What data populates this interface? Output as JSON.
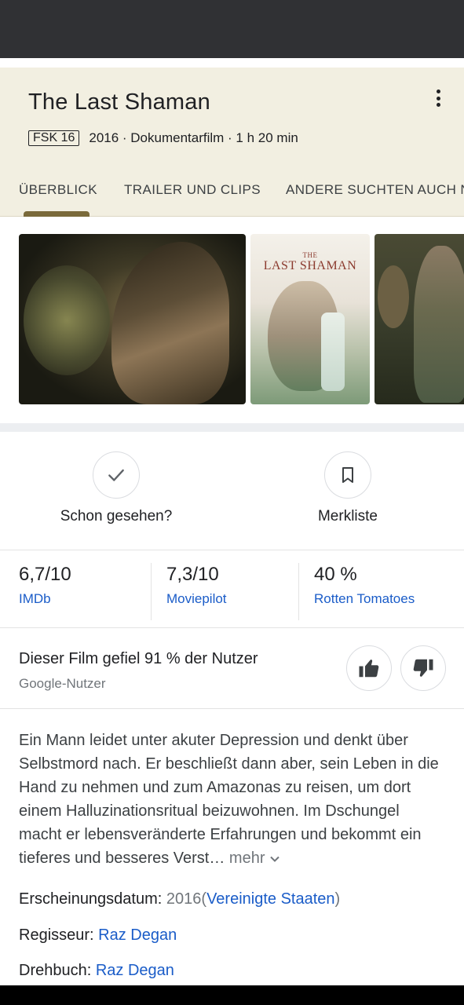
{
  "header": {
    "title": "The Last Shaman",
    "rating_badge": "FSK 16",
    "meta": "2016 · Dokumentarfilm · 1 h 20 min"
  },
  "tabs": [
    {
      "label": "ÜBERBLICK",
      "active": true
    },
    {
      "label": "TRAILER UND CLIPS",
      "active": false
    },
    {
      "label": "ANDERE SUCHTEN AUCH NACH",
      "active": false
    }
  ],
  "gallery": {
    "poster_title_line1": "THE",
    "poster_title_line2": "LAST SHAMAN"
  },
  "actions": {
    "seen_label": "Schon gesehen?",
    "watchlist_label": "Merkliste"
  },
  "ratings": [
    {
      "value": "6,7/10",
      "source": "IMDb"
    },
    {
      "value": "7,3/10",
      "source": "Moviepilot"
    },
    {
      "value": "40 %",
      "source": "Rotten Tomatoes"
    }
  ],
  "audience": {
    "text": "Dieser Film gefiel 91 % der Nutzer",
    "source": "Google-Nutzer"
  },
  "description": {
    "text": "Ein Mann leidet unter akuter Depression und denkt über Selbstmord nach. Er beschließt dann aber, sein Leben in die Hand zu nehmen und zum Amazonas zu reisen, um dort einem Halluzinationsritual beizuwohnen. Im Dschungel macht er lebensveränderte Erfahrungen und bekommt ein tieferes und besseres Verst…",
    "more_label": "mehr"
  },
  "details": {
    "release_label": "Erscheinungsdatum:",
    "release_year": "2016",
    "release_country": "Vereinigte Staaten",
    "director_label": "Regisseur:",
    "director": "Raz Degan",
    "writer_label": "Drehbuch:",
    "writer": "Raz Degan"
  },
  "colors": {
    "header_bg": "#f2efe1",
    "link": "#1a5cc8",
    "tab_indicator": "#7a6a3a"
  }
}
